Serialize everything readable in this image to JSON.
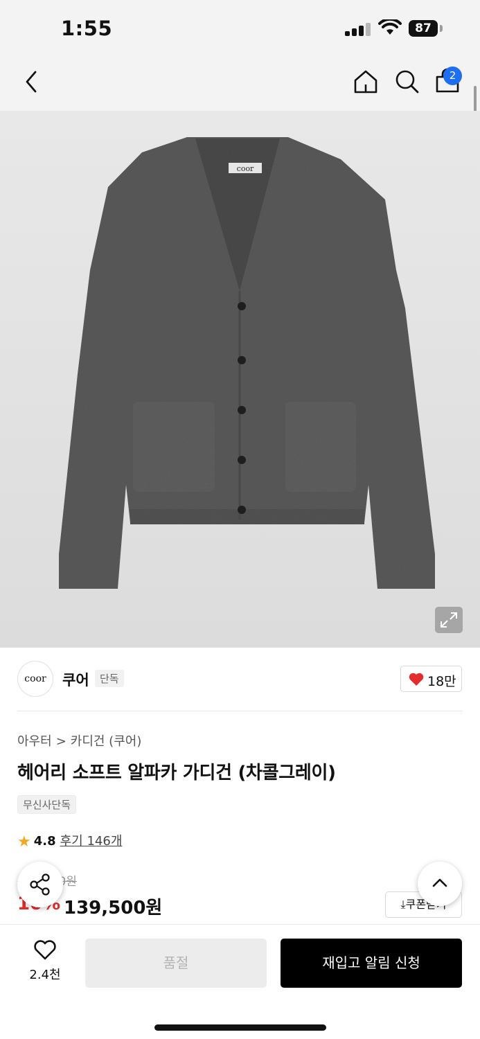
{
  "status_bar": {
    "time": "1:55",
    "battery": "87"
  },
  "nav": {
    "cart_badge": "2"
  },
  "product_image": {
    "label_text": "coor",
    "garment_color": "#5a5a5a"
  },
  "brand": {
    "logo_text": "coor",
    "name": "쿠어",
    "tag": "단독",
    "likes": "18만"
  },
  "breadcrumb": {
    "category": "아우터",
    "separator": ">",
    "sub_category": "카디건 (쿠어)"
  },
  "product": {
    "title": "헤어리 소프트 알파카 가디건 (차콜그레이)",
    "exclusive_tag": "무신사단독",
    "rating": "4.8",
    "reviews": "후기 146개",
    "original_price": "155,000원",
    "discount": "10%",
    "price": "139,500원",
    "coupon_label": "쿠폰받기"
  },
  "bottom_bar": {
    "wish_count": "2.4천",
    "soldout_label": "품절",
    "restock_label": "재입고 알림 신청"
  },
  "colors": {
    "accent_red": "#e42c2c",
    "badge_blue": "#1e6ef2",
    "star": "#f5a623"
  }
}
